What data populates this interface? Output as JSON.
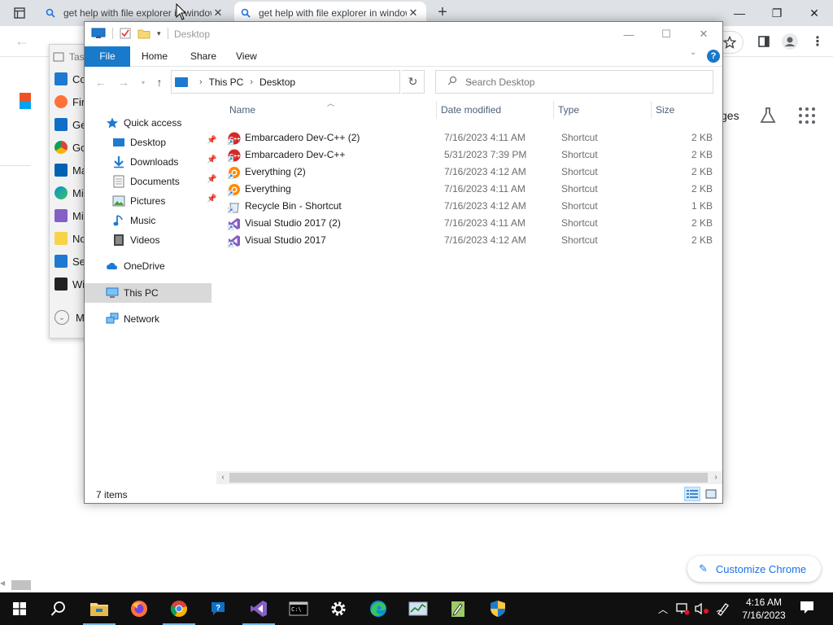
{
  "chrome": {
    "tabs": [
      {
        "title": "get help with file explorer in windows"
      },
      {
        "title": "get help with file explorer in windows"
      }
    ],
    "images_label": "ges",
    "customize_label": "Customize Chrome"
  },
  "start_menu": {
    "search_placeholder": "Tas",
    "items": [
      {
        "label": "Co",
        "color": "#1e7ad1"
      },
      {
        "label": "Fire",
        "color": "#ff7139"
      },
      {
        "label": "Ge",
        "color": "#0f6fc6"
      },
      {
        "label": "Go",
        "color": "#db4437"
      },
      {
        "label": "Ma",
        "color": "#0063b1"
      },
      {
        "label": "Mi",
        "color": "#0c8fd6"
      },
      {
        "label": "Mi",
        "color": "#865fc5"
      },
      {
        "label": "No",
        "color": "#f7d34a"
      },
      {
        "label": "Set",
        "color": "#1e7ad1"
      },
      {
        "label": "Wi",
        "color": "#222222"
      }
    ],
    "more_label": "M"
  },
  "explorer": {
    "title": "Desktop",
    "ribbon_tabs": [
      "File",
      "Home",
      "Share",
      "View"
    ],
    "address": {
      "root": "This PC",
      "folder": "Desktop"
    },
    "search_placeholder": "Search Desktop",
    "nav_pane": {
      "quick_access": "Quick access",
      "pinned": [
        {
          "label": "Desktop",
          "icon": "desktop-icon"
        },
        {
          "label": "Downloads",
          "icon": "downloads-icon"
        },
        {
          "label": "Documents",
          "icon": "documents-icon"
        },
        {
          "label": "Pictures",
          "icon": "pictures-icon"
        },
        {
          "label": "Music",
          "icon": "music-icon"
        },
        {
          "label": "Videos",
          "icon": "videos-icon"
        }
      ],
      "onedrive": "OneDrive",
      "this_pc": "This PC",
      "network": "Network"
    },
    "columns": {
      "name": "Name",
      "date": "Date modified",
      "type": "Type",
      "size": "Size"
    },
    "files": [
      {
        "name": "Embarcadero Dev-C++ (2)",
        "date": "7/16/2023 4:11 AM",
        "type": "Shortcut",
        "size": "2 KB",
        "icon": "devcpp-icon"
      },
      {
        "name": "Embarcadero Dev-C++",
        "date": "5/31/2023 7:39 PM",
        "type": "Shortcut",
        "size": "2 KB",
        "icon": "devcpp-icon"
      },
      {
        "name": "Everything (2)",
        "date": "7/16/2023 4:12 AM",
        "type": "Shortcut",
        "size": "2 KB",
        "icon": "everything-icon"
      },
      {
        "name": "Everything",
        "date": "7/16/2023 4:11 AM",
        "type": "Shortcut",
        "size": "2 KB",
        "icon": "everything-icon"
      },
      {
        "name": "Recycle Bin - Shortcut",
        "date": "7/16/2023 4:12 AM",
        "type": "Shortcut",
        "size": "1 KB",
        "icon": "recycle-bin-icon"
      },
      {
        "name": "Visual Studio 2017 (2)",
        "date": "7/16/2023 4:11 AM",
        "type": "Shortcut",
        "size": "2 KB",
        "icon": "visual-studio-icon"
      },
      {
        "name": "Visual Studio 2017",
        "date": "7/16/2023 4:12 AM",
        "type": "Shortcut",
        "size": "2 KB",
        "icon": "visual-studio-icon"
      }
    ],
    "status": "7 items"
  },
  "taskbar": {
    "apps": [
      "file-explorer",
      "firefox",
      "chrome",
      "get-help",
      "visual-studio",
      "command-prompt",
      "settings",
      "edge",
      "task-manager",
      "notepad-plus",
      "security"
    ],
    "time": "4:16 AM",
    "date": "7/16/2023"
  }
}
